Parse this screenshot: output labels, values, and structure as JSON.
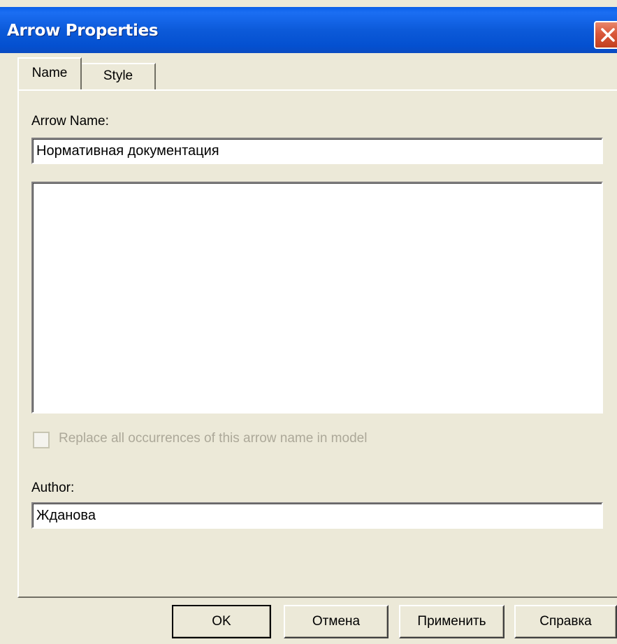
{
  "window": {
    "title": "Arrow Properties",
    "close_icon": "close-icon",
    "close_color": "#d9573a",
    "titlebar_color": "#0c5ad9"
  },
  "tabs": [
    {
      "label": "Name",
      "active": true
    },
    {
      "label": "Style",
      "active": false
    }
  ],
  "name_tab": {
    "arrow_name_label": "Arrow Name:",
    "arrow_name_value": "Нормативная документация",
    "note_value": "",
    "replace_checkbox_label": "Replace all occurrences of this arrow name in model",
    "replace_checkbox_checked": false,
    "replace_checkbox_enabled": false,
    "author_label": "Author:",
    "author_value": "Жданова"
  },
  "buttons": {
    "ok": "OK",
    "cancel": "Отмена",
    "apply": "Применить",
    "help": "Справка"
  }
}
